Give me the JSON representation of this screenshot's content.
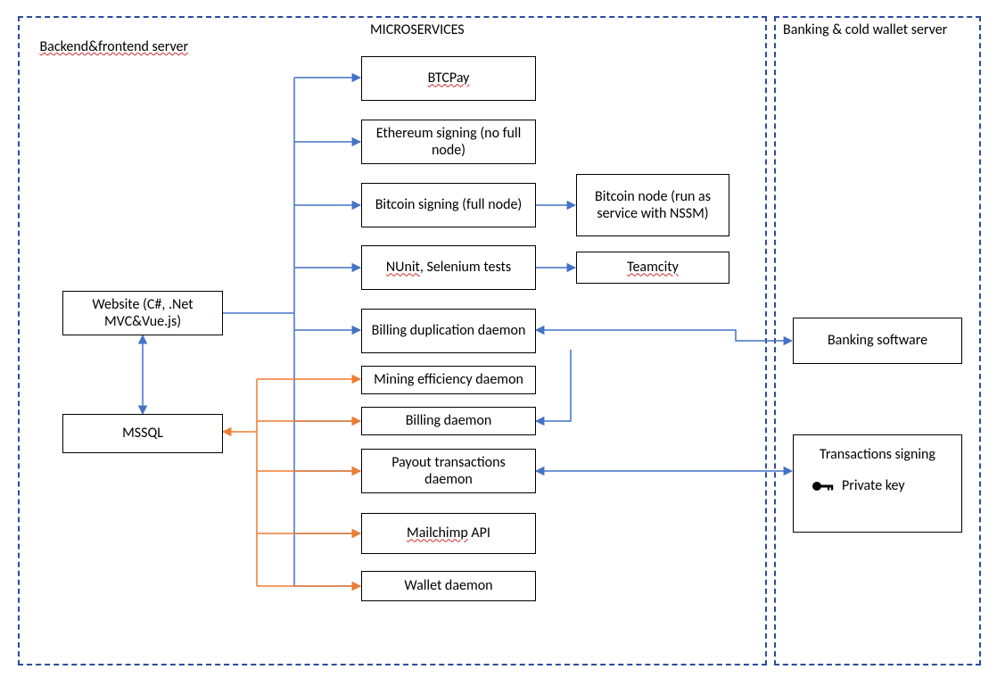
{
  "regions": {
    "backend": {
      "title": "Backend&frontend server"
    },
    "banking": {
      "title": "Banking & cold wallet server"
    }
  },
  "microservices_title": "MICROSERVICES",
  "boxes": {
    "website": {
      "label": "Website (C#, .Net MVC&Vue.js)"
    },
    "mssql": {
      "label": "MSSQL"
    },
    "btcpay": {
      "label": "BTCPay"
    },
    "ethsign": {
      "label": "Ethereum signing (no full node)"
    },
    "btcsign": {
      "label": "Bitcoin signing (full node)"
    },
    "nunit": {
      "label_a": "NUnit",
      "label_b": ", Selenium tests"
    },
    "billingdup": {
      "label": "Billing duplication daemon"
    },
    "mining": {
      "label": "Mining efficiency daemon"
    },
    "billing": {
      "label": "Billing daemon"
    },
    "payout": {
      "label": "Payout transactions daemon"
    },
    "mailchimp": {
      "label_a": "Mailchimp",
      "label_b": " API"
    },
    "wallet": {
      "label": "Wallet daemon"
    },
    "btcnode": {
      "label": "Bitcoin node (run as service with NSSM)"
    },
    "teamcity": {
      "label": "Teamcity"
    },
    "banksoft": {
      "label": "Banking software"
    },
    "txsign": {
      "label": "Transactions signing",
      "private_key": "Private key"
    }
  },
  "colors": {
    "dash": "#2e4a9e",
    "blue": "#4472c4",
    "orange": "#ed7d31"
  }
}
